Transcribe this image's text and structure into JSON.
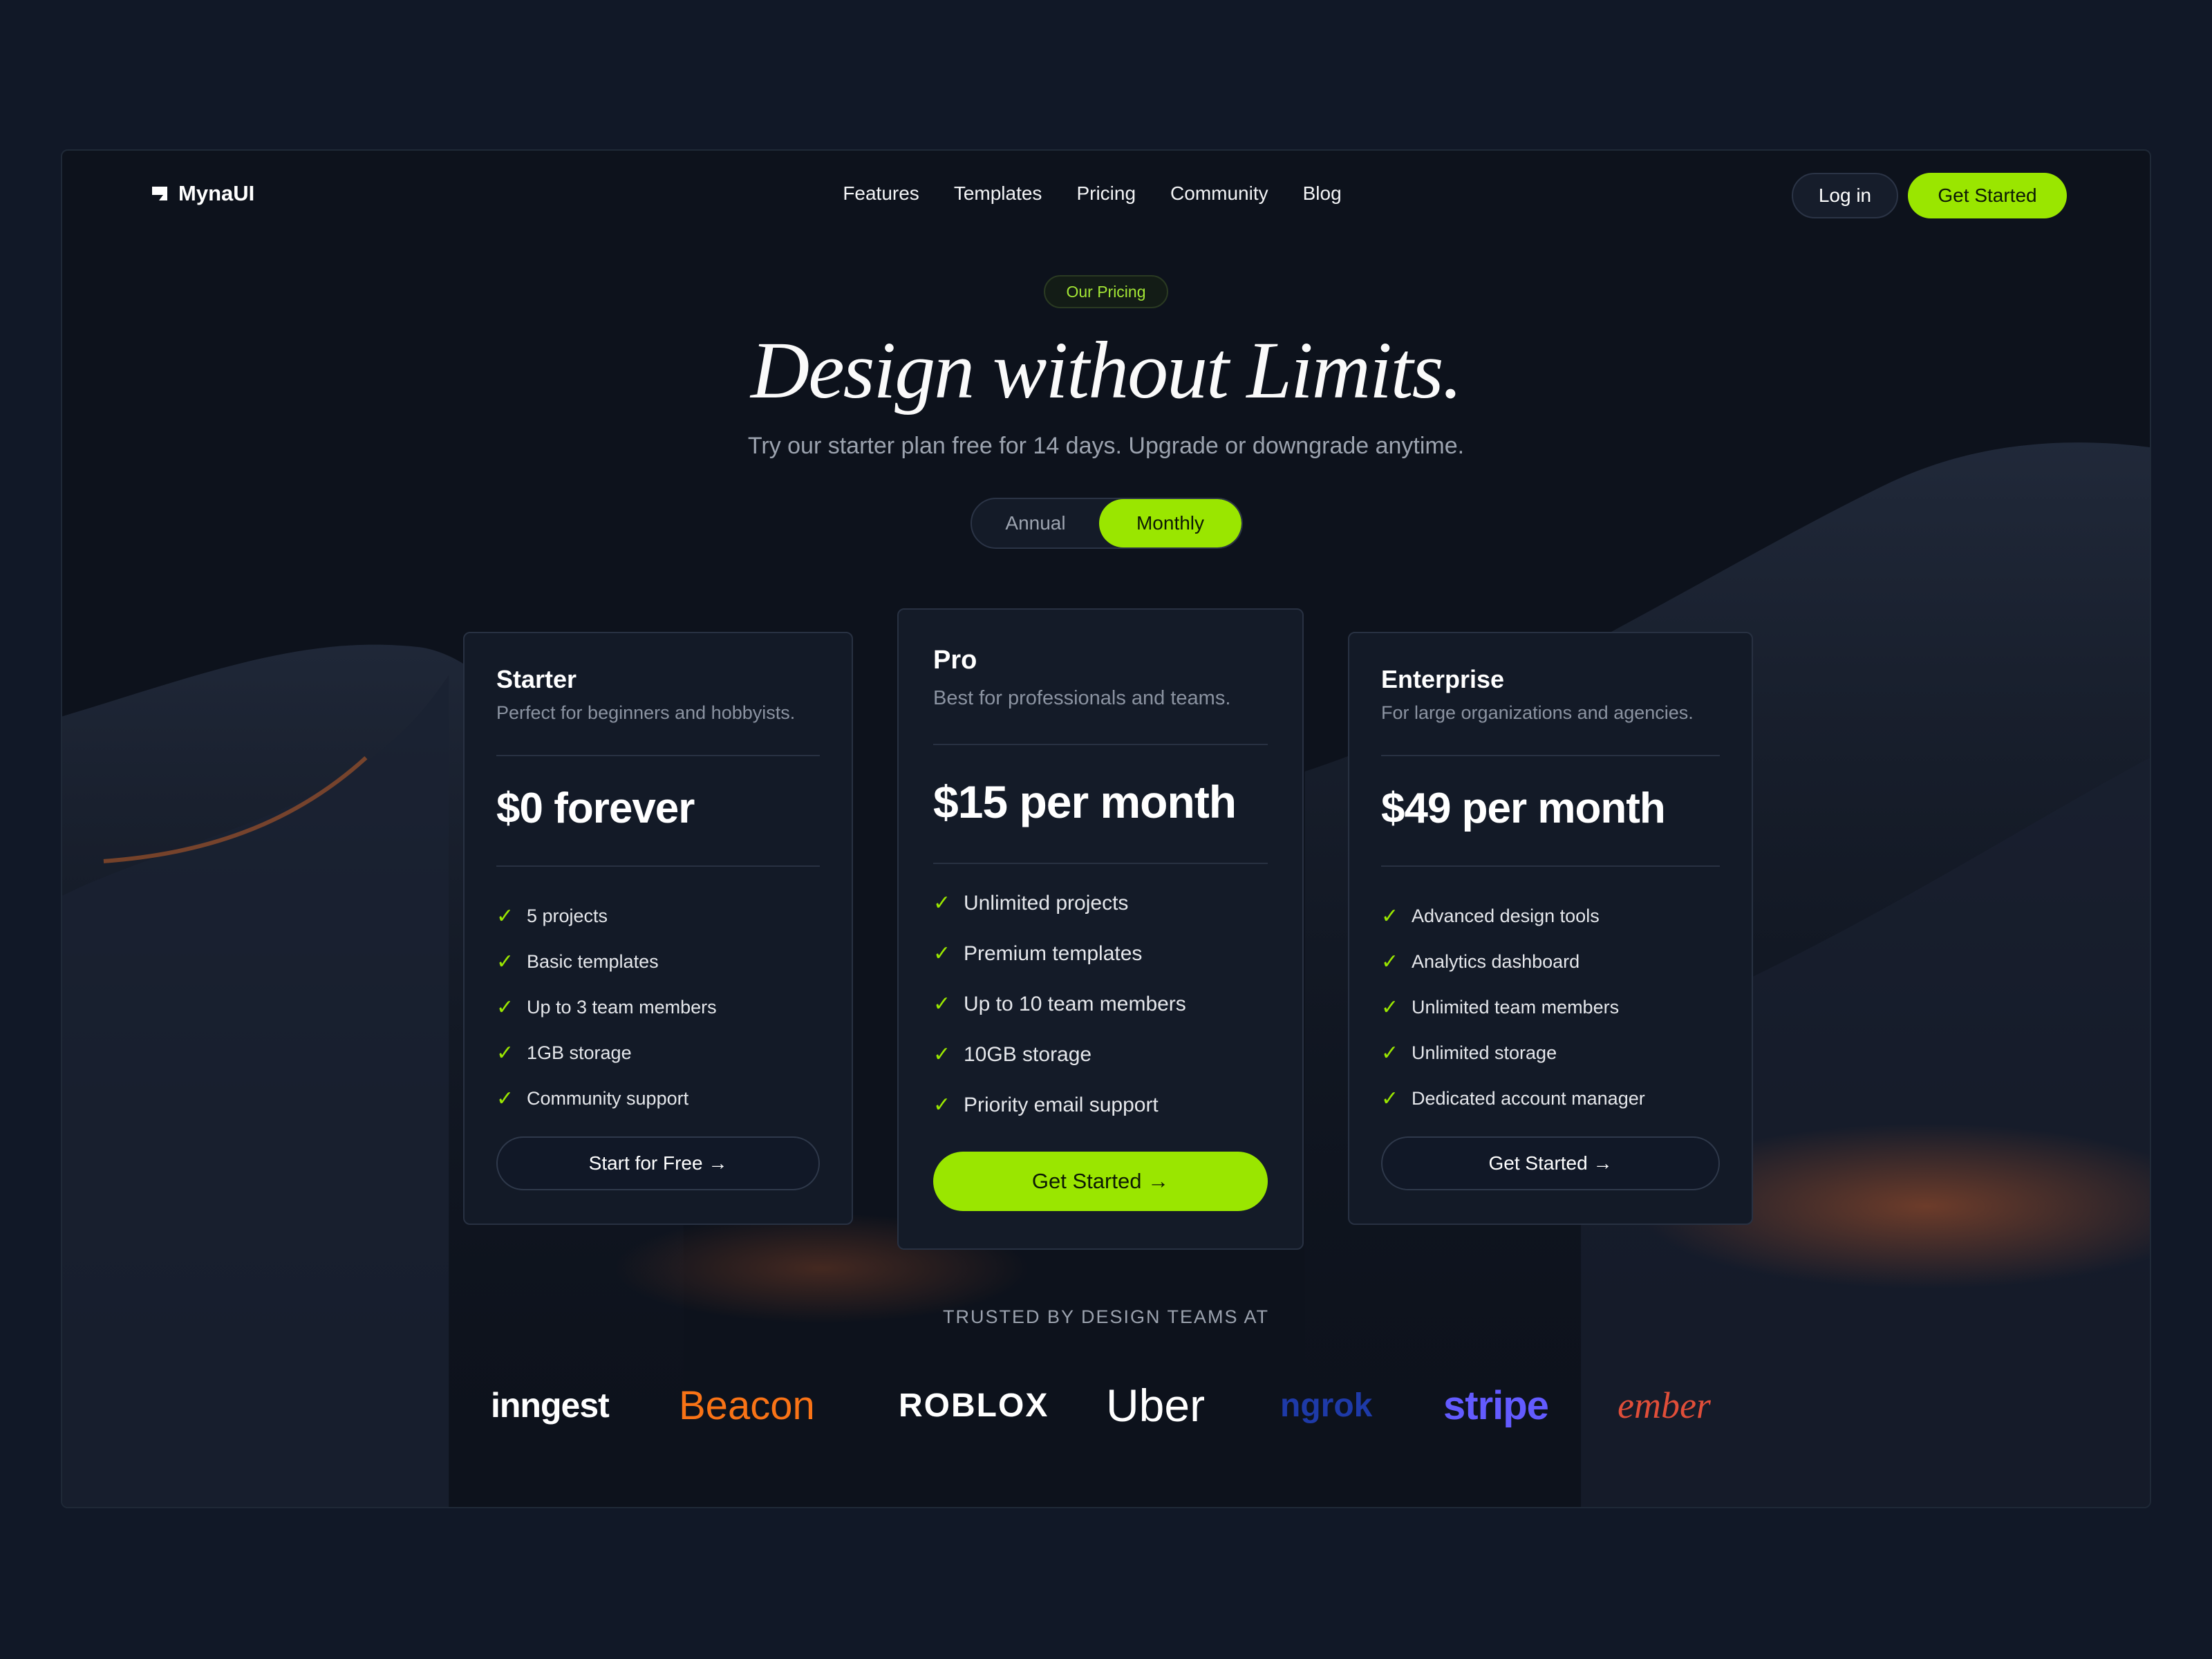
{
  "app": {
    "name": "MynaUI"
  },
  "nav": {
    "links": [
      "Features",
      "Templates",
      "Pricing",
      "Community",
      "Blog"
    ],
    "login_label": "Log in",
    "cta_label": "Get Started"
  },
  "hero": {
    "badge": "Our Pricing",
    "title": "Design without Limits.",
    "subtitle": "Try our starter plan free for 14 days. Upgrade or downgrade anytime.",
    "billing_toggle": {
      "options": [
        "Annual",
        "Monthly"
      ],
      "selected": "Monthly"
    }
  },
  "plans": [
    {
      "name": "Starter",
      "description": "Perfect for beginners and hobbyists.",
      "price": "$0 forever",
      "features": [
        "5 projects",
        "Basic templates",
        "Up to 3 team members",
        "1GB storage",
        "Community support"
      ],
      "button": "Start for Free →"
    },
    {
      "name": "Pro",
      "description": "Best for professionals and teams.",
      "price": "$15 per month",
      "features": [
        "Unlimited projects",
        "Premium templates",
        "Up to 10 team members",
        "10GB storage",
        "Priority email support"
      ],
      "button": "Get Started →"
    },
    {
      "name": "Enterprise",
      "description": "For large organizations and agencies.",
      "price": "$49 per month",
      "features": [
        "Advanced design tools",
        "Analytics dashboard",
        "Unlimited team members",
        "Unlimited storage",
        "Dedicated account manager"
      ],
      "button": "Get Started →"
    }
  ],
  "trusted": {
    "heading": "TRUSTED BY DESIGN TEAMS AT",
    "logos": [
      {
        "name": "inngest",
        "color": "#ffffff"
      },
      {
        "name": "Beacon",
        "color": "#f97316"
      },
      {
        "name": "ROBLOX",
        "color": "#ffffff"
      },
      {
        "name": "Uber",
        "color": "#ffffff"
      },
      {
        "name": "ngrok",
        "color": "#1e3aa8"
      },
      {
        "name": "stripe",
        "color": "#635bff"
      },
      {
        "name": "ember",
        "color": "#e04e39"
      }
    ]
  },
  "colors": {
    "accent": "#9ae600",
    "background": "#111827",
    "card": "#131a27"
  }
}
